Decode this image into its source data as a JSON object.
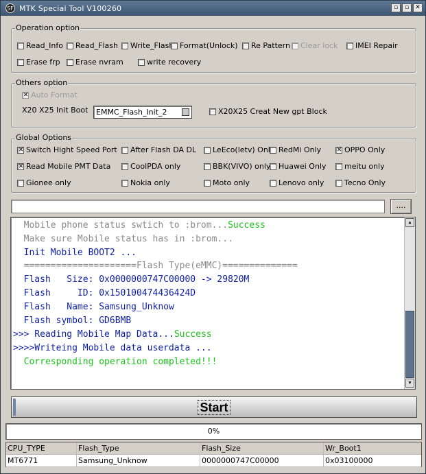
{
  "window": {
    "title": "MTK Special Tool V100260",
    "icon": "mtk-app-icon",
    "icon_glyph": "SF",
    "buttons": [
      "▫",
      "▫",
      "✕"
    ]
  },
  "operation_option": {
    "legend": "Operation option",
    "items": [
      {
        "label": "Read_Info",
        "checked": false
      },
      {
        "label": "Read_Flash",
        "checked": false
      },
      {
        "label": "Write_Flash",
        "checked": false
      },
      {
        "label": "Format(Unlock)",
        "checked": false
      },
      {
        "label": "Re Pattern lo",
        "checked": false
      },
      {
        "label": "Clear lock",
        "checked": false,
        "disabled": true
      },
      {
        "label": "IMEI Repair",
        "checked": false
      },
      {
        "label": "Erase frp",
        "checked": false
      },
      {
        "label": "Erase nvram",
        "checked": false
      },
      {
        "label": "write recovery",
        "checked": false
      }
    ]
  },
  "others_option": {
    "legend": "Others option",
    "auto_format": {
      "label": "Auto Format",
      "checked": true,
      "disabled": true
    },
    "init_boot_label": "X20 X25 Init Boot",
    "init_boot_value": "EMMC_Flash_Init_2",
    "gpt": {
      "label": "X20X25 Creat New gpt Block",
      "checked": false
    }
  },
  "global_options": {
    "legend": "Global Options",
    "items": [
      {
        "label": "Switch Hight Speed Port",
        "checked": true
      },
      {
        "label": "After Flash DA DL",
        "checked": false
      },
      {
        "label": "LeEco(letv) Only",
        "checked": false
      },
      {
        "label": "RedMi Only",
        "checked": false
      },
      {
        "label": "OPPO Only",
        "checked": true
      },
      {
        "label": "Read Mobile PMT Data",
        "checked": true
      },
      {
        "label": "CoolPDA only",
        "checked": false
      },
      {
        "label": "BBK(VIVO) only",
        "checked": false
      },
      {
        "label": "Huawei Only",
        "checked": false
      },
      {
        "label": "meitu only",
        "checked": false
      },
      {
        "label": "Gionee only",
        "checked": false
      },
      {
        "label": "Nokia only",
        "checked": false
      },
      {
        "label": "Moto only",
        "checked": false
      },
      {
        "label": "Lenovo only",
        "checked": false
      },
      {
        "label": "Tecno Only",
        "checked": false
      }
    ]
  },
  "file": {
    "path": "",
    "browse_label": "...."
  },
  "log": {
    "lines": [
      {
        "text": "  Mobile phone status swtich to :brom...",
        "color": "gray",
        "suffix": "Success"
      },
      {
        "text": "  Make sure Mobile status has in :brom...",
        "color": "gray",
        "suffix": ""
      },
      {
        "text": "  Init Mobile BOOT2 ...",
        "color": "blue",
        "suffix": ""
      },
      {
        "text": "  =====================Flash Type(eMMC)==============",
        "color": "gray",
        "suffix": ""
      },
      {
        "text": "  Flash   Size: 0x0000000747C00000 -> 29820M",
        "color": "blue",
        "suffix": ""
      },
      {
        "text": "  Flash     ID: 0x150100474436424D",
        "color": "blue",
        "suffix": ""
      },
      {
        "text": "  Flash   Name: Samsung_Unknow",
        "color": "blue",
        "suffix": ""
      },
      {
        "text": "  Flash symbol: GD6BMB",
        "color": "blue",
        "suffix": ""
      },
      {
        "text": ">>> Reading Mobile Map Data...",
        "color": "blue",
        "suffix": "Success"
      },
      {
        "text": ">>>>Writeing Mobile data userdata ...",
        "color": "blue",
        "suffix": ""
      },
      {
        "text": "  Corresponding operation completed!!!",
        "color": "green",
        "suffix": ""
      }
    ],
    "scroll_up_icon": "▲",
    "scroll_down_icon": "▼"
  },
  "start_button": {
    "label": "Start"
  },
  "progress": {
    "text": "0%",
    "value": 0
  },
  "info_table": {
    "headers": [
      "CPU_TYPE",
      "Flash_Type",
      "Flash_Size",
      "Wr_Boot1"
    ],
    "rows": [
      [
        "MT6771",
        "Samsung_Unknow",
        "0000000747C00000",
        "0x03100000"
      ]
    ]
  },
  "colors": {
    "log_gray": "#8a8a8a",
    "log_blue": "#0d1fa8",
    "log_green": "#1dc21d",
    "titlebar": "#4d6680"
  }
}
